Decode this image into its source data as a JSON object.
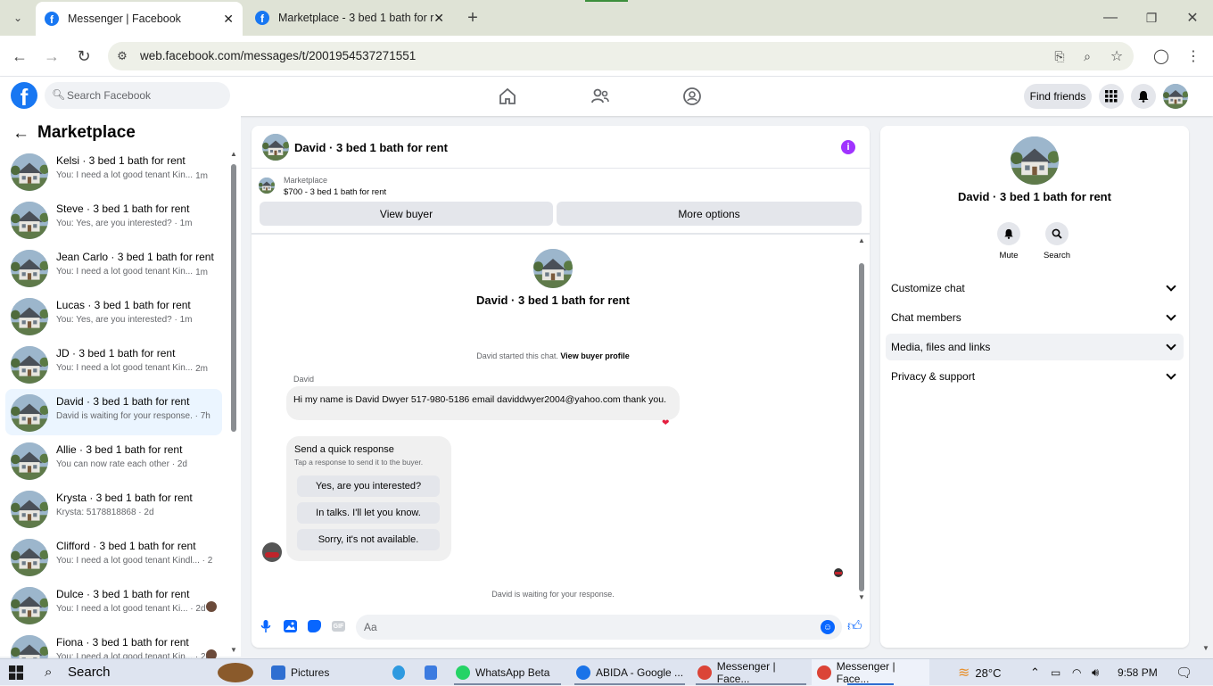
{
  "browser": {
    "tabs": [
      {
        "title": "Messenger | Facebook",
        "active": true
      },
      {
        "title": "Marketplace - 3 bed 1 bath for r",
        "active": false
      }
    ],
    "url": "web.facebook.com/messages/t/2001954537271551"
  },
  "fb": {
    "search_placeholder": "Search Facebook",
    "find_friends": "Find friends"
  },
  "left": {
    "title": "Marketplace",
    "conversations": [
      {
        "name": "Kelsi · 3 bed 1 bath for rent",
        "preview": "You: I need a lot good tenant Kin...",
        "time": "1m"
      },
      {
        "name": "Steve · 3 bed 1 bath for rent",
        "preview": "You: Yes, are you interested? · 1m",
        "time": ""
      },
      {
        "name": "Jean Carlo · 3 bed 1 bath for rent",
        "preview": "You: I need a lot good tenant Kin...",
        "time": "1m"
      },
      {
        "name": "Lucas · 3 bed 1 bath for rent",
        "preview": "You: Yes, are you interested? · 1m",
        "time": ""
      },
      {
        "name": "JD · 3 bed 1 bath for rent",
        "preview": "You: I need a lot good tenant Kin...",
        "time": "2m"
      },
      {
        "name": "David · 3 bed 1 bath for rent",
        "preview": "David is waiting for your response. · 7h",
        "time": ""
      },
      {
        "name": "Allie · 3 bed 1 bath for rent",
        "preview": "You can now rate each other · 2d",
        "time": ""
      },
      {
        "name": "Krysta · 3 bed 1 bath for rent",
        "preview": "Krysta: 5178818868 · 2d",
        "time": ""
      },
      {
        "name": "Clifford · 3 bed 1 bath for rent",
        "preview": "You: I need a lot good tenant Kindl... · 2d",
        "time": ""
      },
      {
        "name": "Dulce · 3 bed 1 bath for rent",
        "preview": "You: I need a lot good tenant Ki... · 2d",
        "time": ""
      },
      {
        "name": "Fiona · 3 bed 1 bath for rent",
        "preview": "You: I need a lot good tenant Kin... · 2d",
        "time": ""
      }
    ]
  },
  "chat": {
    "title": "David · 3 bed 1 bath for rent",
    "listing_label": "Marketplace",
    "listing_price": "$700 - 3 bed 1 bath for rent",
    "view_buyer": "View buyer",
    "more_options": "More options",
    "intro_name": "David · 3 bed 1 bath for rent",
    "started_text": "David started this chat.",
    "view_buyer_profile": "View buyer profile",
    "sender": "David",
    "message": "Hi my name is David Dwyer 517-980-5186 email daviddwyer2004@yahoo.com thank you.",
    "reaction": "❤️",
    "quick_title": "Send a quick response",
    "quick_sub": "Tap a response to send it to the buyer.",
    "quick_options": [
      "Yes, are you interested?",
      "In talks. I'll let you know.",
      "Sorry, it's not available."
    ],
    "waiting": "David is waiting for your response.",
    "composer_placeholder": "Aa"
  },
  "right": {
    "name": "David · 3 bed 1 bath for rent",
    "mute": "Mute",
    "search": "Search",
    "menu": [
      "Customize chat",
      "Chat members",
      "Media, files and links",
      "Privacy & support"
    ]
  },
  "taskbar": {
    "search": "Search",
    "items": [
      "Pictures",
      "WhatsApp Beta",
      "ABIDA - Google ...",
      "Messenger | Face...",
      "Messenger | Face..."
    ],
    "temp": "28°C",
    "time": "9:58 PM"
  },
  "colors": {
    "fb_blue": "#1877f2",
    "purple_info": "#a033ff"
  }
}
